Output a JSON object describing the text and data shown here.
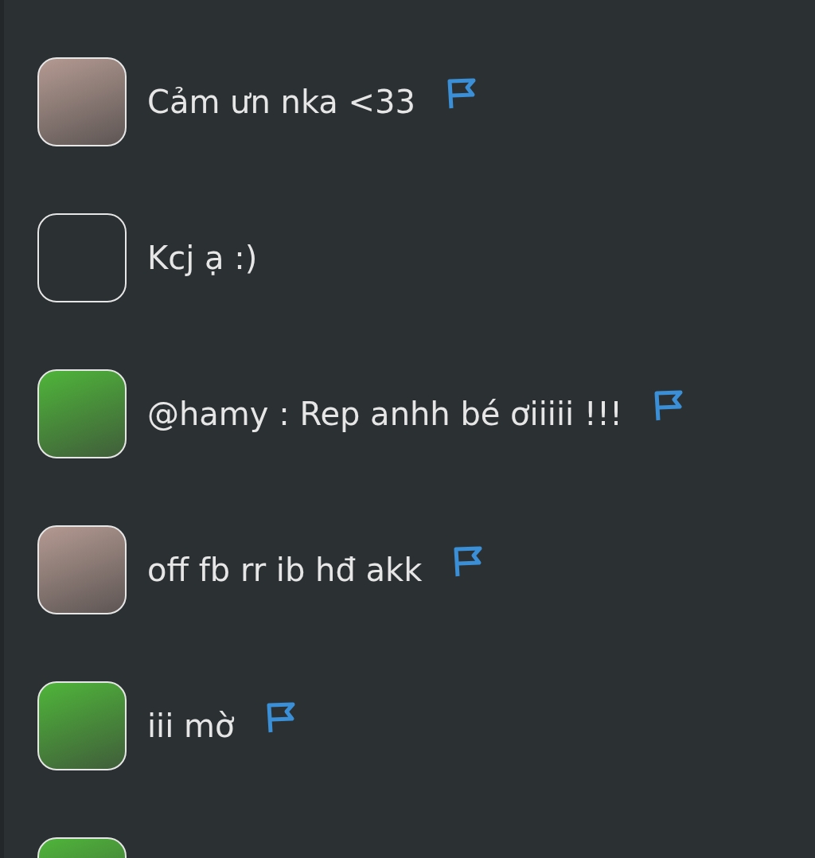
{
  "comments": [
    {
      "avatar": {
        "kind": "photo",
        "color": "#b49a92"
      },
      "message": "Cảm ưn nka <33",
      "flag": true
    },
    {
      "avatar": {
        "kind": "none"
      },
      "message": "Kcj ạ :)",
      "flag": false
    },
    {
      "avatar": {
        "kind": "photo",
        "color": "#4fb53a"
      },
      "message": "@hamy : Rep anhh bé ơiiiii !!!",
      "flag": true
    },
    {
      "avatar": {
        "kind": "photo",
        "color": "#b49a92"
      },
      "message": "off fb rr ib hđ akk",
      "flag": true
    },
    {
      "avatar": {
        "kind": "photo",
        "color": "#4fb53a"
      },
      "message": "iii mờ",
      "flag": true
    },
    {
      "avatar": {
        "kind": "photo",
        "color": "#4fb53a"
      }
    }
  ]
}
